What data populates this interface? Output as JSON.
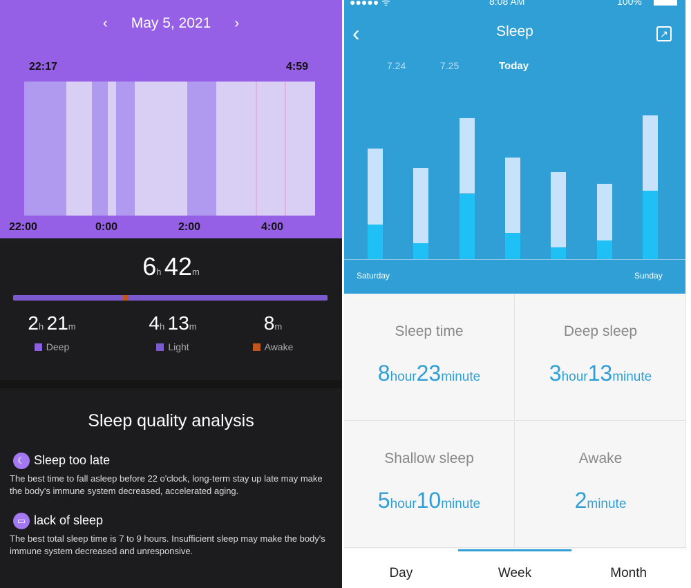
{
  "left": {
    "date": "May 5, 2021",
    "prev_icon": "chevron-left-icon",
    "next_icon": "chevron-right-icon",
    "start_time": "22:17",
    "end_time": "4:59",
    "axis_labels": [
      "22:00",
      "0:00",
      "2:00",
      "4:00"
    ],
    "colors": {
      "deep": "#b09af0",
      "light": "#d9cff5",
      "awake": "#e0b4d8",
      "bar_deep": "#8a5fe0",
      "bar_light": "#6f4dc0",
      "bar_awake": "#c0561e"
    },
    "stages": [
      {
        "stage": "deep",
        "start": "22:17",
        "end": "23:15"
      },
      {
        "stage": "light",
        "start": "23:15",
        "end": "23:51"
      },
      {
        "stage": "deep",
        "start": "23:51",
        "end": "00:13"
      },
      {
        "stage": "light",
        "start": "00:13",
        "end": "00:24"
      },
      {
        "stage": "deep",
        "start": "00:24",
        "end": "00:50"
      },
      {
        "stage": "light",
        "start": "00:50",
        "end": "02:02"
      },
      {
        "stage": "deep",
        "start": "02:02",
        "end": "02:42"
      },
      {
        "stage": "light",
        "start": "02:42",
        "end": "03:37"
      },
      {
        "stage": "awake",
        "start": "03:37",
        "end": "03:39"
      },
      {
        "stage": "light",
        "start": "03:39",
        "end": "04:17"
      },
      {
        "stage": "awake",
        "start": "04:17",
        "end": "04:19"
      },
      {
        "stage": "light",
        "start": "04:19",
        "end": "04:59"
      }
    ],
    "total": {
      "h": "6",
      "hu": "h",
      "m": "42",
      "mu": "m"
    },
    "stats": [
      {
        "h": "2",
        "hu": "h",
        "m": "21",
        "mu": "m",
        "label": "Deep",
        "color": "#8a5fe0"
      },
      {
        "h": "4",
        "hu": "h",
        "m": "13",
        "mu": "m",
        "label": "Light",
        "color": "#7b5ad0"
      },
      {
        "h": "",
        "hu": "",
        "m": "8",
        "mu": "m",
        "label": "Awake",
        "color": "#c0561e"
      }
    ],
    "analysis_title": "Sleep quality analysis",
    "items": [
      {
        "icon": "moon-icon",
        "title": "Sleep too late",
        "text": "The best time to fall asleep before 22 o'clock, long-term stay up late may make the body's immune system decreased, accelerated aging."
      },
      {
        "icon": "battery-icon",
        "title": "lack of sleep",
        "text": "The best total sleep time is 7 to 9 hours. Insufficient sleep may make the body's immune system decreased and unresponsive."
      }
    ]
  },
  "right": {
    "status": {
      "time": "8:08 AM",
      "battery": "100%"
    },
    "title": "Sleep",
    "back_icon": "back-chevron-icon",
    "share_icon": "share-icon",
    "dates": [
      "7.24",
      "7.25",
      "Today"
    ],
    "chart_data": {
      "type": "bar",
      "stacked": true,
      "x_start_label": "Saturday",
      "x_end_label": "Sunday",
      "series": [
        {
          "values": [
            0.24,
            0.11,
            0.45,
            0.18,
            0.08,
            0.13,
            0.47
          ]
        },
        {
          "values": [
            0.52,
            0.52,
            0.52,
            0.52,
            0.52,
            0.39,
            0.52
          ]
        }
      ],
      "colors": [
        "#1ec0f5",
        "#c6e3fb"
      ]
    },
    "cells": [
      {
        "title": "Sleep time",
        "n1": "8",
        "u1": "hour",
        "n2": "23",
        "u2": "minute"
      },
      {
        "title": "Deep sleep",
        "n1": "3",
        "u1": "hour",
        "n2": "13",
        "u2": "minute"
      },
      {
        "title": "Shallow sleep",
        "n1": "5",
        "u1": "hour",
        "n2": "10",
        "u2": "minute"
      },
      {
        "title": "Awake",
        "n1": "",
        "u1": "",
        "n2": "2",
        "u2": "minute"
      }
    ],
    "tabs": [
      "Day",
      "Week",
      "Month"
    ],
    "active_tab": 1
  }
}
